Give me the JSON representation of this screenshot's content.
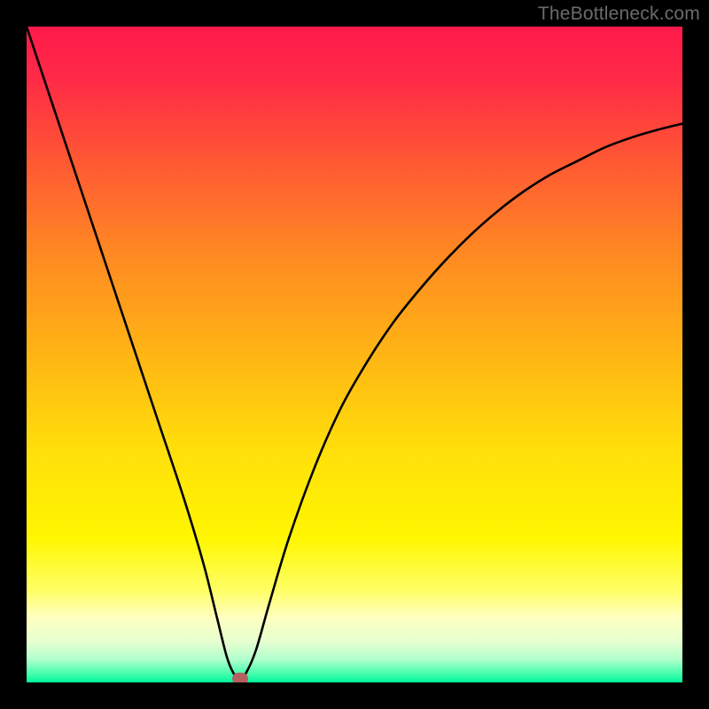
{
  "watermark": {
    "text": "TheBottleneck.com"
  },
  "colors": {
    "frame": "#000000",
    "curve": "#000000",
    "marker": "#b46060",
    "gradient_stops": [
      {
        "offset": 0.0,
        "color": "#ff1a4b"
      },
      {
        "offset": 0.08,
        "color": "#ff2a46"
      },
      {
        "offset": 0.2,
        "color": "#ff5634"
      },
      {
        "offset": 0.35,
        "color": "#ff8a22"
      },
      {
        "offset": 0.5,
        "color": "#ffb514"
      },
      {
        "offset": 0.65,
        "color": "#ffe00a"
      },
      {
        "offset": 0.78,
        "color": "#fff600"
      },
      {
        "offset": 0.86,
        "color": "#ffff66"
      },
      {
        "offset": 0.9,
        "color": "#ffffc0"
      },
      {
        "offset": 0.94,
        "color": "#e4ffd0"
      },
      {
        "offset": 0.965,
        "color": "#b0ffcc"
      },
      {
        "offset": 0.985,
        "color": "#4dffb0"
      },
      {
        "offset": 1.0,
        "color": "#00f59a"
      }
    ]
  },
  "chart_data": {
    "type": "line",
    "title": "",
    "xlabel": "",
    "ylabel": "",
    "xlim": [
      0,
      100
    ],
    "ylim": [
      0,
      100
    ],
    "series": [
      {
        "name": "bottleneck-curve",
        "x": [
          0,
          4,
          8,
          12,
          16,
          20,
          24,
          27,
          29,
          30.5,
          31.5,
          32.5,
          33.5,
          35,
          37,
          40,
          44,
          48,
          52,
          56,
          60,
          64,
          68,
          72,
          76,
          80,
          84,
          88,
          92,
          96,
          100
        ],
        "y": [
          100,
          88,
          76,
          64,
          52,
          40,
          28,
          18,
          10,
          4,
          1.5,
          0.5,
          1.5,
          5,
          12,
          22,
          33,
          42,
          49,
          55,
          60,
          64.5,
          68.5,
          72,
          75,
          77.5,
          79.5,
          81.5,
          83,
          84.2,
          85.2
        ]
      }
    ],
    "marker": {
      "x": 32.5,
      "y": 0.5
    }
  }
}
